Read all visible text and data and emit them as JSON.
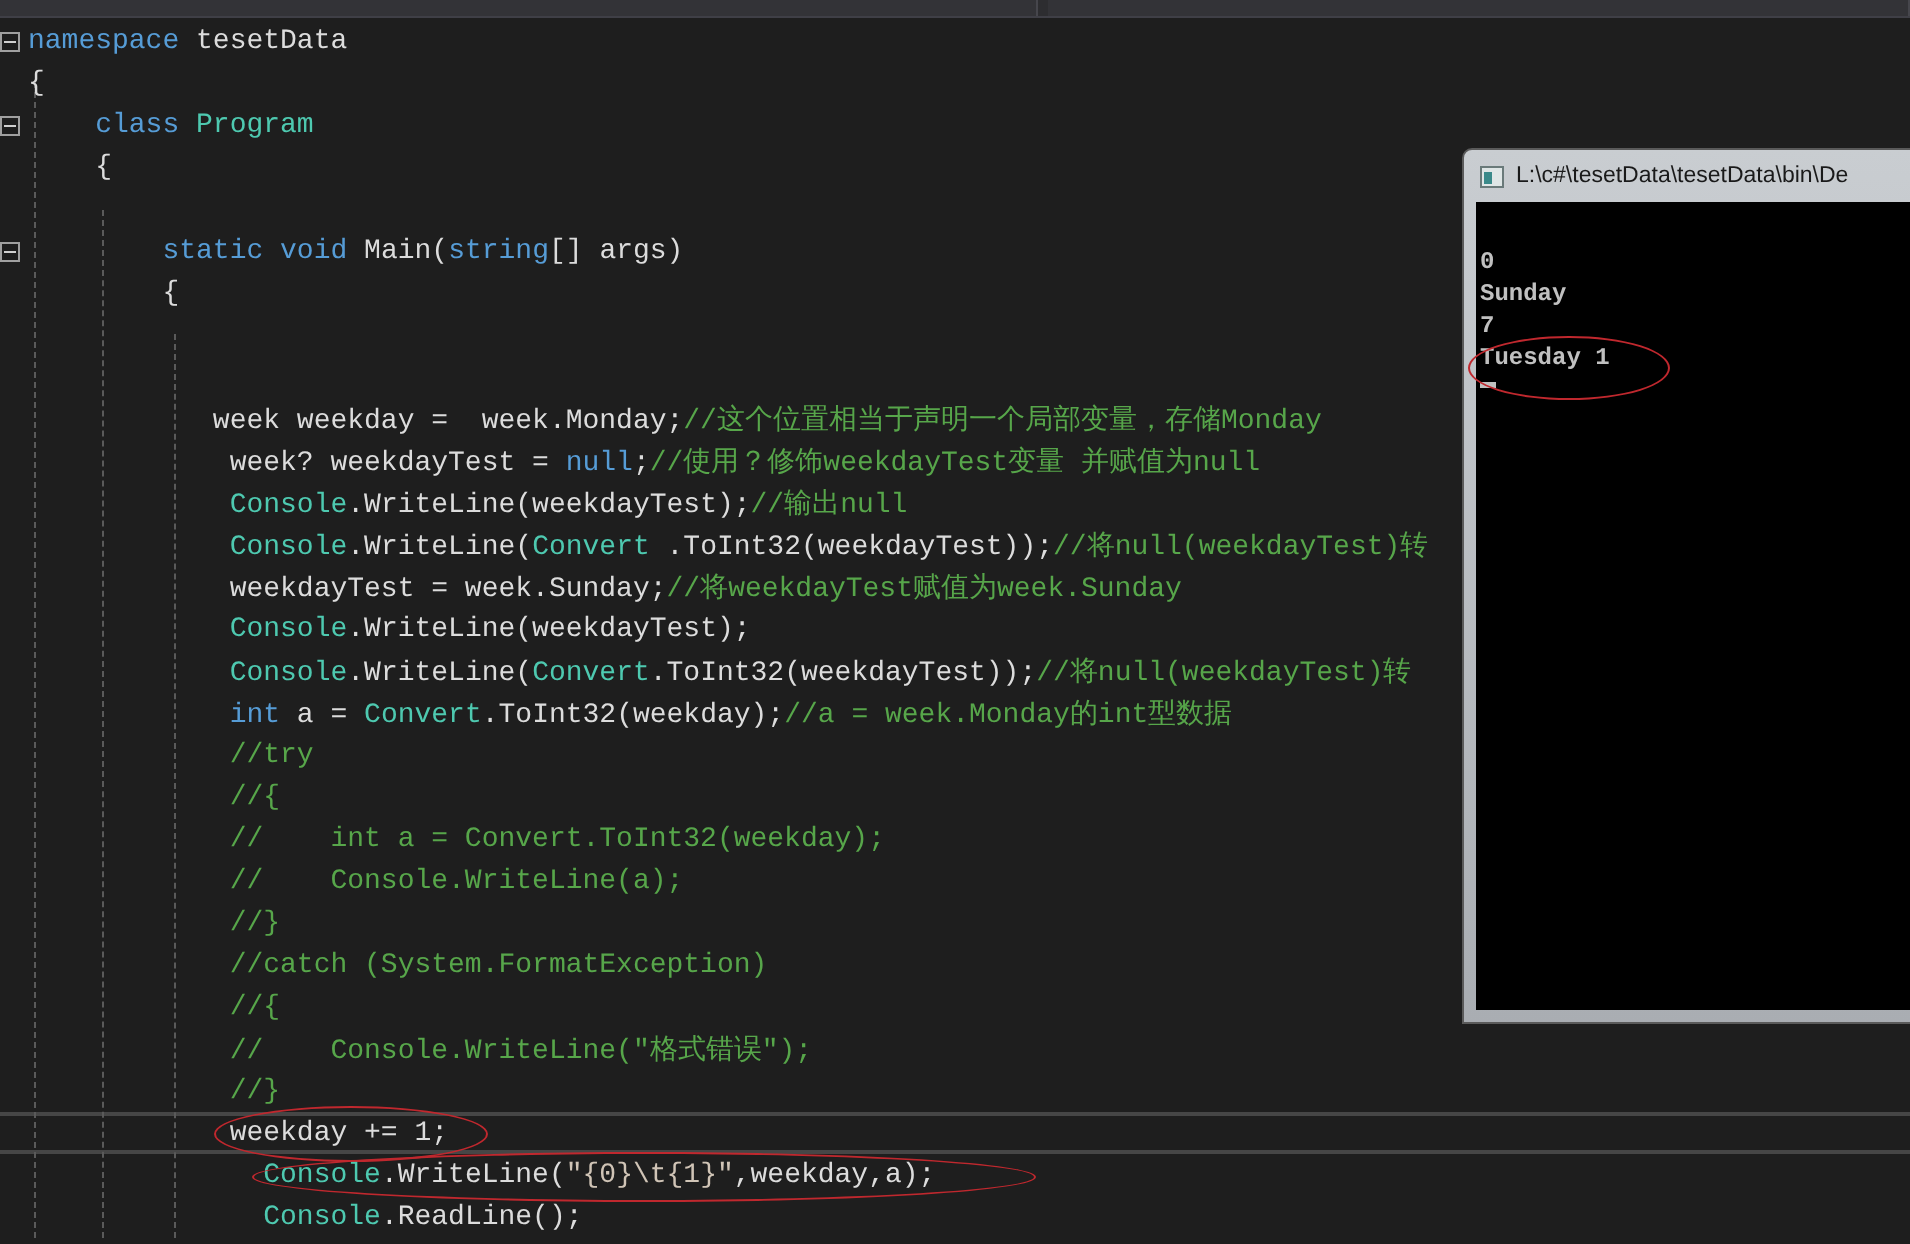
{
  "editor": {
    "lines": [
      {
        "fold": true,
        "current": false,
        "circled": false,
        "tokens": [
          {
            "kind": "keyword",
            "text": "namespace"
          },
          {
            "kind": "plain",
            "text": " tesetData"
          }
        ]
      },
      {
        "fold": false,
        "current": false,
        "circled": false,
        "tokens": [
          {
            "kind": "plain",
            "text": "{"
          }
        ]
      },
      {
        "fold": true,
        "current": false,
        "circled": false,
        "tokens": [
          {
            "kind": "keyword",
            "text": "    class"
          },
          {
            "kind": "type",
            "text": " Program"
          }
        ]
      },
      {
        "fold": false,
        "current": false,
        "circled": false,
        "tokens": [
          {
            "kind": "plain",
            "text": "    {"
          }
        ]
      },
      {
        "fold": false,
        "current": false,
        "circled": false
      },
      {
        "fold": true,
        "current": false,
        "circled": false,
        "tokens": [
          {
            "kind": "keyword",
            "text": "        static"
          },
          {
            "kind": "keyword",
            "text": " void"
          },
          {
            "kind": "plain",
            "text": " Main("
          },
          {
            "kind": "keyword",
            "text": "string"
          },
          {
            "kind": "plain",
            "text": "[] args)"
          }
        ]
      },
      {
        "fold": false,
        "current": false,
        "circled": false,
        "tokens": [
          {
            "kind": "plain",
            "text": "        {"
          }
        ]
      },
      {
        "fold": false,
        "current": false,
        "circled": false
      },
      {
        "fold": false,
        "current": false,
        "circled": false
      },
      {
        "fold": false,
        "current": false,
        "circled": false,
        "tokens": [
          {
            "kind": "plain",
            "text": "           week weekday =  week.Monday;"
          },
          {
            "kind": "comment",
            "text": "//这个位置相当于声明一个局部变量，存储Monday"
          }
        ]
      },
      {
        "fold": false,
        "current": false,
        "circled": false,
        "tokens": [
          {
            "kind": "plain",
            "text": "            week? weekdayTest = "
          },
          {
            "kind": "keyword",
            "text": "null"
          },
          {
            "kind": "plain",
            "text": ";"
          },
          {
            "kind": "comment",
            "text": "//使用？修饰weekdayTest变量 并赋值为null"
          }
        ]
      },
      {
        "fold": false,
        "current": false,
        "circled": false,
        "tokens": [
          {
            "kind": "type",
            "text": "            Console"
          },
          {
            "kind": "plain",
            "text": ".WriteLine(weekdayTest);"
          },
          {
            "kind": "comment",
            "text": "//输出null"
          }
        ]
      },
      {
        "fold": false,
        "current": false,
        "circled": false,
        "tokens": [
          {
            "kind": "type",
            "text": "            Console"
          },
          {
            "kind": "plain",
            "text": ".WriteLine("
          },
          {
            "kind": "type",
            "text": "Convert"
          },
          {
            "kind": "plain",
            "text": " .ToInt32(weekdayTest));"
          },
          {
            "kind": "comment",
            "text": "//将null(weekdayTest)转"
          }
        ]
      },
      {
        "fold": false,
        "current": false,
        "circled": false,
        "tokens": [
          {
            "kind": "plain",
            "text": "            weekdayTest = week.Sunday;"
          },
          {
            "kind": "comment",
            "text": "//将weekdayTest赋值为week.Sunday"
          }
        ]
      },
      {
        "fold": false,
        "current": false,
        "circled": false,
        "tokens": [
          {
            "kind": "type",
            "text": "            Console"
          },
          {
            "kind": "plain",
            "text": ".WriteLine(weekdayTest);"
          }
        ]
      },
      {
        "fold": false,
        "current": false,
        "circled": false,
        "tokens": [
          {
            "kind": "type",
            "text": "            Console"
          },
          {
            "kind": "plain",
            "text": ".WriteLine("
          },
          {
            "kind": "type",
            "text": "Convert"
          },
          {
            "kind": "plain",
            "text": ".ToInt32(weekdayTest));"
          },
          {
            "kind": "comment",
            "text": "//将null(weekdayTest)转"
          }
        ]
      },
      {
        "fold": false,
        "current": false,
        "circled": false,
        "tokens": [
          {
            "kind": "keyword",
            "text": "            int"
          },
          {
            "kind": "plain",
            "text": " a = "
          },
          {
            "kind": "type",
            "text": "Convert"
          },
          {
            "kind": "plain",
            "text": ".ToInt32(weekday);"
          },
          {
            "kind": "comment",
            "text": "//a = week.Monday的int型数据"
          }
        ]
      },
      {
        "fold": false,
        "current": false,
        "circled": false,
        "tokens": [
          {
            "kind": "comment",
            "text": "            //try"
          }
        ]
      },
      {
        "fold": false,
        "current": false,
        "circled": false,
        "tokens": [
          {
            "kind": "comment",
            "text": "            //{"
          }
        ]
      },
      {
        "fold": false,
        "current": false,
        "circled": false,
        "tokens": [
          {
            "kind": "comment",
            "text": "            //    int a = Convert.ToInt32(weekday);"
          }
        ]
      },
      {
        "fold": false,
        "current": false,
        "circled": false,
        "tokens": [
          {
            "kind": "comment",
            "text": "            //    Console.WriteLine(a);"
          }
        ]
      },
      {
        "fold": false,
        "current": false,
        "circled": false,
        "tokens": [
          {
            "kind": "comment",
            "text": "            //}"
          }
        ]
      },
      {
        "fold": false,
        "current": false,
        "circled": false,
        "tokens": [
          {
            "kind": "comment",
            "text": "            //catch (System.FormatException)"
          }
        ]
      },
      {
        "fold": false,
        "current": false,
        "circled": false,
        "tokens": [
          {
            "kind": "comment",
            "text": "            //{"
          }
        ]
      },
      {
        "fold": false,
        "current": false,
        "circled": false,
        "tokens": [
          {
            "kind": "comment",
            "text": "            //    Console.WriteLine(\"格式错误\");"
          }
        ]
      },
      {
        "fold": false,
        "current": false,
        "circled": false,
        "tokens": [
          {
            "kind": "comment",
            "text": "            //}"
          }
        ]
      },
      {
        "fold": false,
        "current": true,
        "circled": true,
        "tokens": [
          {
            "kind": "plain",
            "text": "            weekday += 1;"
          }
        ]
      },
      {
        "fold": false,
        "current": false,
        "circled": true,
        "tokens": [
          {
            "kind": "type",
            "text": "              Console"
          },
          {
            "kind": "plain",
            "text": ".WriteLine("
          },
          {
            "kind": "string",
            "text": "\"{0}\\t{1}\""
          },
          {
            "kind": "plain",
            "text": ",weekday,a);"
          }
        ]
      },
      {
        "fold": false,
        "current": false,
        "circled": false,
        "tokens": [
          {
            "kind": "type",
            "text": "              Console"
          },
          {
            "kind": "plain",
            "text": ".ReadLine();"
          }
        ]
      }
    ]
  },
  "console_window": {
    "title": "L:\\c#\\tesetData\\tesetData\\bin\\De",
    "lines": [
      {
        "text": "0",
        "circled": false
      },
      {
        "text": "Sunday",
        "circled": false
      },
      {
        "text": "7",
        "circled": false
      },
      {
        "text": "Tuesday 1",
        "circled": true
      }
    ]
  }
}
